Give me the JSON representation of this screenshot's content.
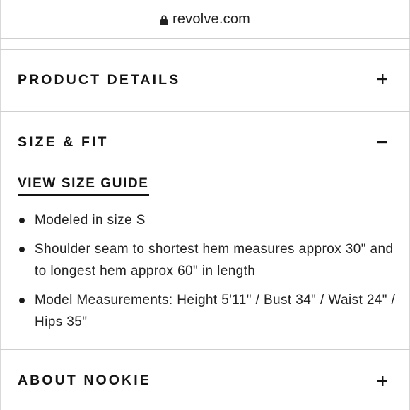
{
  "browser": {
    "url": "revolve.com"
  },
  "sections": {
    "product_details": {
      "title": "PRODUCT DETAILS",
      "toggle": "+"
    },
    "size_fit": {
      "title": "SIZE & FIT",
      "toggle": "−",
      "size_guide_link": "VIEW SIZE GUIDE",
      "bullets": [
        "Modeled in size S",
        "Shoulder seam to shortest hem measures approx 30\" and to longest hem approx 60\" in length",
        "Model Measurements: Height 5'11\" / Bust 34\" / Waist 24\" / Hips 35\""
      ]
    },
    "about": {
      "title": "ABOUT NOOKIE",
      "toggle": "+"
    }
  }
}
